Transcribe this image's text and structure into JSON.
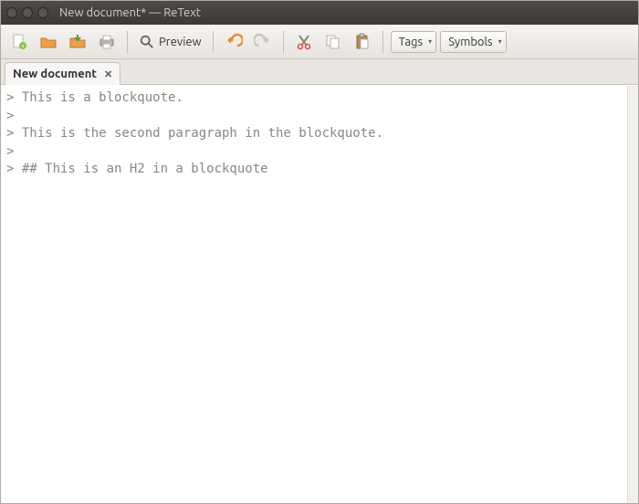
{
  "window": {
    "title": "New document* — ReText"
  },
  "toolbar": {
    "preview_label": "Preview",
    "tags_label": "Tags",
    "symbols_label": "Symbols"
  },
  "tabs": [
    {
      "label": "New document"
    }
  ],
  "editor": {
    "lines": [
      "> This is a blockquote.",
      ">",
      "> This is the second paragraph in the blockquote.",
      ">",
      "> ## This is an H2 in a blockquote"
    ]
  },
  "icons": {
    "new": "new-file-icon",
    "open": "open-file-icon",
    "save": "save-icon",
    "print": "print-icon",
    "zoom": "search-icon",
    "undo": "undo-icon",
    "redo": "redo-icon",
    "cut": "cut-icon",
    "copy": "copy-icon",
    "paste": "paste-icon"
  }
}
